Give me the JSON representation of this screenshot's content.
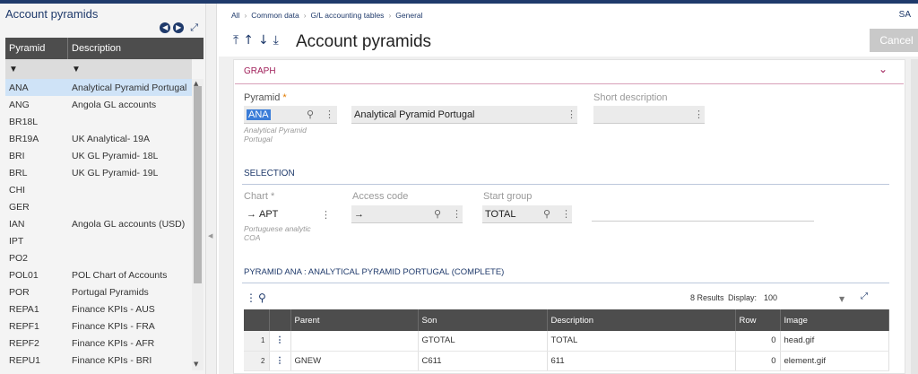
{
  "left_panel": {
    "title": "Account pyramids",
    "columns": [
      "Pyramid",
      "Description"
    ],
    "filter_icons": [
      "filter-icon",
      "filter-icon"
    ],
    "rows": [
      {
        "code": "ANA",
        "desc": "Analytical Pyramid Portugal",
        "selected": true
      },
      {
        "code": "ANG",
        "desc": "Angola GL accounts"
      },
      {
        "code": "BR18L",
        "desc": ""
      },
      {
        "code": "BR19A",
        "desc": "UK Analytical- 19A"
      },
      {
        "code": "BRI",
        "desc": "UK GL Pyramid- 18L"
      },
      {
        "code": "BRL",
        "desc": "UK GL Pyramid- 19L"
      },
      {
        "code": "CHI",
        "desc": ""
      },
      {
        "code": "GER",
        "desc": ""
      },
      {
        "code": "IAN",
        "desc": "Angola GL accounts (USD)"
      },
      {
        "code": "IPT",
        "desc": ""
      },
      {
        "code": "PO2",
        "desc": ""
      },
      {
        "code": "POL01",
        "desc": "POL Chart of Accounts"
      },
      {
        "code": "POR",
        "desc": "Portugal Pyramids"
      },
      {
        "code": "REPA1",
        "desc": "Finance KPIs - AUS"
      },
      {
        "code": "REPF1",
        "desc": "Finance KPIs - FRA"
      },
      {
        "code": "REPF2",
        "desc": "Finance KPIs - AFR"
      },
      {
        "code": "REPU1",
        "desc": "Finance KPIs - BRI"
      }
    ]
  },
  "breadcrumb": [
    "All",
    "Common data",
    "G/L accounting tables",
    "General"
  ],
  "user_badge": "SA",
  "page_title": "Account pyramids",
  "cancel_label": "Cancel",
  "graph_section": {
    "title": "GRAPH",
    "pyramid_label": "Pyramid",
    "pyramid_value": "ANA",
    "pyramid_sub": [
      "Analytical Pyramid",
      "Portugal"
    ],
    "description_value": "Analytical Pyramid Portugal",
    "short_desc_label": "Short description",
    "short_desc_value": ""
  },
  "selection_section": {
    "title": "SELECTION",
    "chart_label": "Chart",
    "chart_value": "APT",
    "chart_sub": [
      "Portuguese analytic",
      "COA"
    ],
    "access_label": "Access code",
    "access_value": "",
    "start_label": "Start group",
    "start_value": "TOTAL"
  },
  "pyramid_section": {
    "title": "PYRAMID ANA : ANALYTICAL PYRAMID PORTUGAL (COMPLETE)",
    "results": "8 Results",
    "display_label": "Display:",
    "display_value": "100",
    "columns": [
      "Parent",
      "Son",
      "Description",
      "Row",
      "Image"
    ],
    "rows": [
      {
        "idx": "1",
        "parent": "",
        "son": "GTOTAL",
        "desc": "TOTAL",
        "row": "0",
        "image": "head.gif"
      },
      {
        "idx": "2",
        "parent": "GNEW",
        "son": "C611",
        "desc": "611",
        "row": "0",
        "image": "element.gif"
      }
    ]
  }
}
